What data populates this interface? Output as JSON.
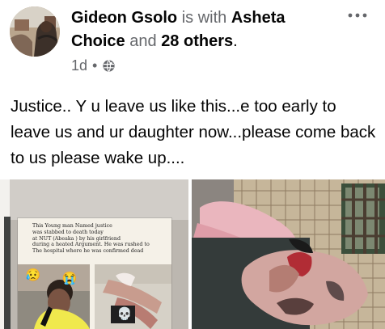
{
  "post": {
    "author_name": "Gideon Gsolo",
    "connector_1": "is with",
    "tagged_name": "Asheta Choice",
    "connector_2": "and",
    "others": "28 others",
    "punctuation": ".",
    "time": "1d",
    "meta_separator": "•",
    "privacy_icon": "globe-icon",
    "more_icon": "more-options-icon",
    "text": "Justice.. Y u leave us like this...e too early to leave us and ur daughter now...please come back to us please wake up...."
  },
  "photos": {
    "left": {
      "caption_lines": [
        "This Young man Named  justice",
        "was stabbed to death today",
        "at NUT (Abeaka ) by his girlfriend",
        "during a heated Argument. He was rushed to",
        "The hospital where he was confirmed dead"
      ],
      "emoji_a": "😥",
      "emoji_b": "😭",
      "emoji_c": "💀"
    },
    "right": {}
  },
  "colors": {
    "text": "#050505",
    "muted": "#65676b",
    "background": "#ffffff",
    "news_bg": "#f5f1e8"
  }
}
